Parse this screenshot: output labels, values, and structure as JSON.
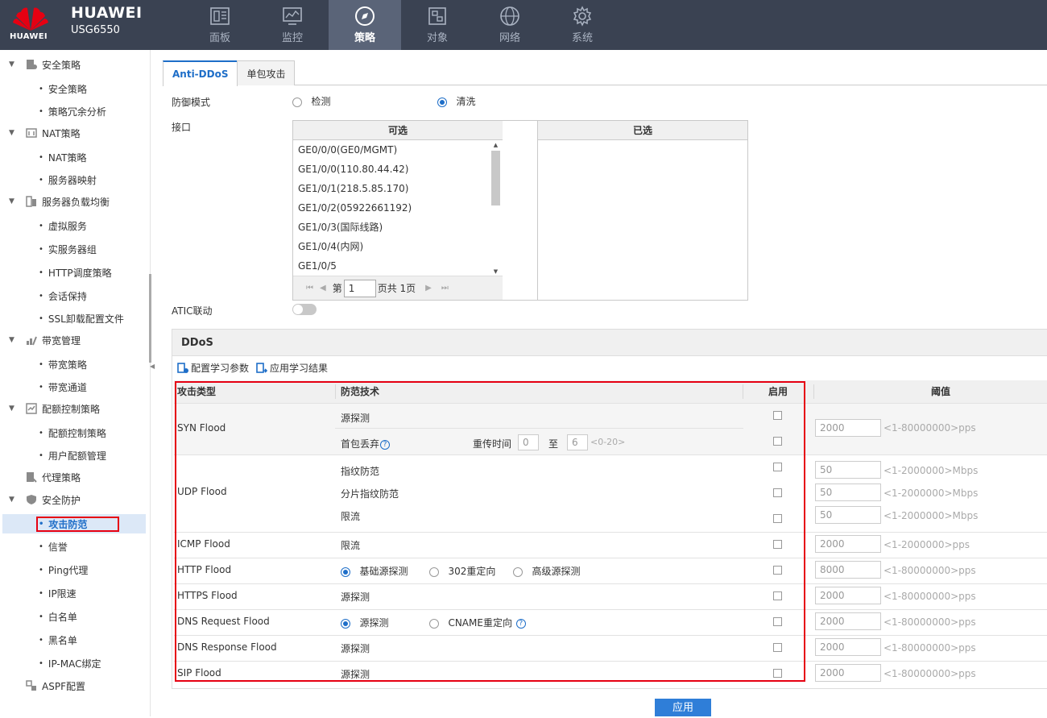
{
  "header": {
    "logo_text": "HUAWEI",
    "brand": "HUAWEI",
    "model": "USG6550",
    "nav": [
      {
        "label": "面板",
        "icon": "dashboard-icon"
      },
      {
        "label": "监控",
        "icon": "monitor-icon"
      },
      {
        "label": "策略",
        "icon": "compass-icon"
      },
      {
        "label": "对象",
        "icon": "object-icon"
      },
      {
        "label": "网络",
        "icon": "globe-icon"
      },
      {
        "label": "系统",
        "icon": "gear-icon"
      }
    ]
  },
  "sidebar": {
    "groups": [
      {
        "label": "安全策略",
        "items": [
          "安全策略",
          "策略冗余分析"
        ]
      },
      {
        "label": "NAT策略",
        "items": [
          "NAT策略",
          "服务器映射"
        ]
      },
      {
        "label": "服务器负载均衡",
        "items": [
          "虚拟服务",
          "实服务器组",
          "HTTP调度策略",
          "会话保持",
          "SSL卸载配置文件"
        ]
      },
      {
        "label": "带宽管理",
        "items": [
          "带宽策略",
          "带宽通道"
        ]
      },
      {
        "label": "配额控制策略",
        "items": [
          "配额控制策略",
          "用户配额管理"
        ]
      },
      {
        "label": "代理策略",
        "items": []
      },
      {
        "label": "安全防护",
        "items": [
          "攻击防范",
          "信誉",
          "Ping代理",
          "IP限速",
          "白名单",
          "黑名单",
          "IP-MAC绑定"
        ]
      },
      {
        "label": "ASPF配置",
        "items": []
      }
    ],
    "active_item": "攻击防范"
  },
  "tabs": [
    "Anti-DDoS",
    "单包攻击"
  ],
  "form": {
    "mode_label": "防御模式",
    "mode_options": [
      "检测",
      "清洗"
    ],
    "mode_selected": "清洗",
    "interface_label": "接口",
    "available_header": "可选",
    "selected_header": "已选",
    "available": [
      "GE0/0/0(GE0/MGMT)",
      "GE1/0/0(110.80.44.42)",
      "GE1/0/1(218.5.85.170)",
      "GE1/0/2(05922661192)",
      "GE1/0/3(国际线路)",
      "GE1/0/4(内网)",
      "GE1/0/5"
    ],
    "pager": {
      "prefix": "第",
      "page": "1",
      "suffix": "页共 1页"
    },
    "move_buttons": [
      "»",
      "›",
      "‹",
      "«"
    ],
    "atic_label": "ATIC联动",
    "atic_enabled": false
  },
  "ddos": {
    "title": "DDoS",
    "link_config": "配置学习参数",
    "link_apply": "应用学习结果",
    "headers": {
      "type": "攻击类型",
      "tech": "防范技术",
      "enable": "启用",
      "threshold": "阈值"
    },
    "syn": {
      "type": "SYN Flood",
      "tech1": "源探测",
      "tech2": "首包丢弃",
      "retrans_label": "重传时间",
      "retrans_min": "0",
      "to": "至",
      "retrans_max": "6",
      "retrans_range": "<0-20>",
      "threshold": "2000",
      "range": "<1-80000000>pps"
    },
    "udp": {
      "type": "UDP Flood",
      "techs": [
        "指纹防范",
        "分片指纹防范",
        "限流"
      ],
      "thresholds": [
        "50",
        "50",
        "50"
      ],
      "range": "<1-2000000>Mbps"
    },
    "icmp": {
      "type": "ICMP Flood",
      "tech": "限流",
      "threshold": "2000",
      "range": "<1-2000000>pps"
    },
    "http": {
      "type": "HTTP Flood",
      "options": [
        "基础源探测",
        "302重定向",
        "高级源探测"
      ],
      "selected": "基础源探测",
      "threshold": "8000",
      "range": "<1-80000000>pps"
    },
    "https": {
      "type": "HTTPS Flood",
      "tech": "源探测",
      "threshold": "2000",
      "range": "<1-80000000>pps"
    },
    "dns_req": {
      "type": "DNS Request Flood",
      "options": [
        "源探测",
        "CNAME重定向"
      ],
      "selected": "源探测",
      "threshold": "2000",
      "range": "<1-80000000>pps"
    },
    "dns_resp": {
      "type": "DNS Response Flood",
      "tech": "源探测",
      "threshold": "2000",
      "range": "<1-80000000>pps"
    },
    "sip": {
      "type": "SIP Flood",
      "tech": "源探测",
      "threshold": "2000",
      "range": "<1-80000000>pps"
    }
  },
  "apply_button": "应用",
  "colors": {
    "topbar": "#3a4252",
    "accent": "#1e6ec8",
    "highlight": "#e60012"
  }
}
